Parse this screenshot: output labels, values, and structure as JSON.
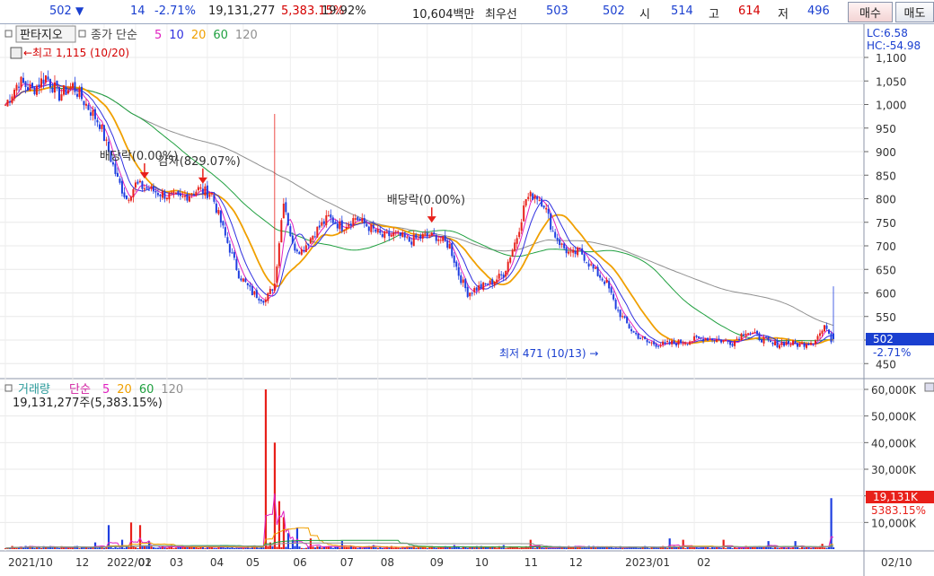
{
  "topbar": {
    "price": "502",
    "down_arrow": "▼",
    "change": "14",
    "change_pct": "-2.71%",
    "volume": "19,131,277",
    "vol_ratio": "5,383.15%",
    "turnover": "19.92%",
    "amount": "10,604백만",
    "bid_label": "최우선",
    "bid1": "503",
    "bid2": "502",
    "open_label": "시",
    "open": "514",
    "high_label": "고",
    "high": "614",
    "low_label": "저",
    "low": "496",
    "buy": "매수",
    "sell": "매도"
  },
  "price_panel": {
    "checkbox": "■",
    "indicator_btn": "판타지오",
    "legend_prefix": "종가 단순",
    "ma_labels": [
      "5",
      "10",
      "20",
      "60",
      "120"
    ],
    "lc": "LC:6.58",
    "hc": "HC:-54.98",
    "current_price": "502",
    "current_change": "-2.71%",
    "high_note": "←최고 1,115 (10/20)",
    "low_note": "최저 471 (10/13) →",
    "events": [
      "배당락(0.00%)",
      "감자(829.07%)",
      "배당락(0.00%)"
    ],
    "y_ticks": [
      "1,100",
      "1,050",
      "1,000",
      "950",
      "900",
      "850",
      "800",
      "750",
      "700",
      "650",
      "600",
      "550",
      "500",
      "450"
    ]
  },
  "volume_panel": {
    "title": "거래량",
    "legend_prefix": "단순",
    "ma_labels": [
      "5",
      "20",
      "60",
      "120"
    ],
    "summary": "19,131,277주(5,383.15%)",
    "current_label": "19,131K",
    "current_ratio": "5383.15%",
    "y_ticks": [
      "60,000K",
      "50,000K",
      "40,000K",
      "30,000K",
      "20,000K",
      "10,000K"
    ]
  },
  "x_ticks": [
    "2021/10",
    "12",
    "2022/01",
    "02",
    "03",
    "04",
    "05",
    "06",
    "07",
    "08",
    "09",
    "10",
    "11",
    "12",
    "2023/01",
    "02",
    "02/10"
  ],
  "colors": {
    "up": "#e8201a",
    "down": "#1f3fe0",
    "ma5": "#e020c0",
    "ma10": "#3030e0",
    "ma20": "#f0a000",
    "ma60": "#20a040",
    "ma120": "#909090"
  },
  "chart_data": {
    "type": "candlestick",
    "anchors": [
      [
        0,
        1000
      ],
      [
        6,
        1050
      ],
      [
        12,
        1030
      ],
      [
        18,
        1060
      ],
      [
        24,
        1020
      ],
      [
        30,
        1040
      ],
      [
        36,
        1000
      ],
      [
        42,
        960
      ],
      [
        46,
        900
      ],
      [
        50,
        840
      ],
      [
        54,
        800
      ],
      [
        58,
        830
      ],
      [
        64,
        820
      ],
      [
        70,
        810
      ],
      [
        78,
        800
      ],
      [
        86,
        820
      ],
      [
        92,
        810
      ],
      [
        98,
        720
      ],
      [
        104,
        640
      ],
      [
        110,
        600
      ],
      [
        116,
        585
      ],
      [
        120,
        620
      ],
      [
        124,
        800
      ],
      [
        128,
        700
      ],
      [
        132,
        690
      ],
      [
        138,
        730
      ],
      [
        144,
        760
      ],
      [
        150,
        740
      ],
      [
        156,
        760
      ],
      [
        162,
        740
      ],
      [
        168,
        720
      ],
      [
        174,
        725
      ],
      [
        180,
        710
      ],
      [
        186,
        720
      ],
      [
        192,
        720
      ],
      [
        198,
        700
      ],
      [
        202,
        640
      ],
      [
        206,
        600
      ],
      [
        210,
        610
      ],
      [
        216,
        620
      ],
      [
        222,
        640
      ],
      [
        228,
        720
      ],
      [
        232,
        800
      ],
      [
        236,
        810
      ],
      [
        240,
        790
      ],
      [
        244,
        730
      ],
      [
        248,
        700
      ],
      [
        252,
        680
      ],
      [
        256,
        690
      ],
      [
        262,
        650
      ],
      [
        268,
        620
      ],
      [
        272,
        570
      ],
      [
        276,
        540
      ],
      [
        280,
        515
      ],
      [
        286,
        495
      ],
      [
        292,
        490
      ],
      [
        300,
        495
      ],
      [
        306,
        500
      ],
      [
        312,
        505
      ],
      [
        318,
        500
      ],
      [
        324,
        495
      ],
      [
        330,
        520
      ],
      [
        336,
        505
      ],
      [
        342,
        490
      ],
      [
        348,
        495
      ],
      [
        354,
        490
      ],
      [
        360,
        498
      ],
      [
        366,
        530
      ],
      [
        368,
        502
      ]
    ],
    "volume_spikes": [
      [
        40,
        2500
      ],
      [
        46,
        9000
      ],
      [
        52,
        3500
      ],
      [
        56,
        10000
      ],
      [
        60,
        9000
      ],
      [
        64,
        3000
      ],
      [
        74,
        1500
      ],
      [
        96,
        1500
      ],
      [
        108,
        1200
      ],
      [
        111,
        1400
      ],
      [
        116,
        60000
      ],
      [
        118,
        2500
      ],
      [
        120,
        40000
      ],
      [
        122,
        18000
      ],
      [
        124,
        12000
      ],
      [
        126,
        6000
      ],
      [
        128,
        3500
      ],
      [
        130,
        8000
      ],
      [
        136,
        4000
      ],
      [
        150,
        3000
      ],
      [
        164,
        1500
      ],
      [
        182,
        1200
      ],
      [
        200,
        1500
      ],
      [
        222,
        1500
      ],
      [
        234,
        3500
      ],
      [
        254,
        1200
      ],
      [
        270,
        1000
      ],
      [
        296,
        4000
      ],
      [
        302,
        3500
      ],
      [
        320,
        3500
      ],
      [
        340,
        3000
      ],
      [
        352,
        3000
      ],
      [
        364,
        2000
      ],
      [
        368,
        19131
      ]
    ],
    "events": [
      [
        62,
        "배당락(0.00%)"
      ],
      [
        88,
        "감자(829.07%)"
      ],
      [
        190,
        "배당락(0.00%)"
      ]
    ],
    "y_range": [
      450,
      1120
    ],
    "vol_range": [
      0,
      62000
    ]
  }
}
